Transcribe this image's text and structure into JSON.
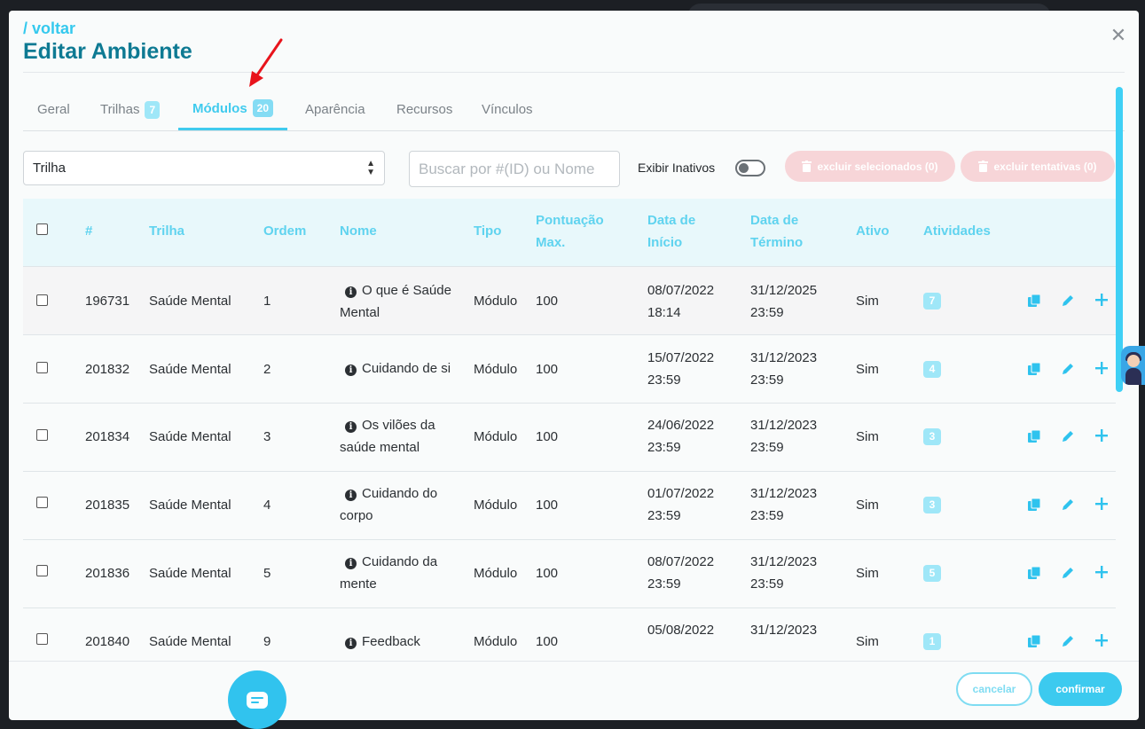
{
  "header": {
    "back_link": "/ voltar",
    "title": "Editar Ambiente",
    "close_symbol": "✕"
  },
  "tabs": [
    {
      "label": "Geral",
      "badge": null
    },
    {
      "label": "Trilhas",
      "badge": "7"
    },
    {
      "label": "Módulos",
      "badge": "20",
      "active": true
    },
    {
      "label": "Aparência",
      "badge": null
    },
    {
      "label": "Recursos",
      "badge": null
    },
    {
      "label": "Vínculos",
      "badge": null
    }
  ],
  "filters": {
    "trail_select_value": "Trilha",
    "search_placeholder": "Buscar por #(ID) ou Nome",
    "show_inactive_label": "Exibir Inativos",
    "show_inactive_on": false,
    "delete_selected_label": "excluir selecionados (0)",
    "delete_attempts_label": "excluir tentativas (0)"
  },
  "table": {
    "headers": {
      "id": "#",
      "trail": "Trilha",
      "order": "Ordem",
      "name": "Nome",
      "type": "Tipo",
      "max_score_l1": "Pontuação",
      "max_score_l2": "Max.",
      "start_l1": "Data de",
      "start_l2": "Início",
      "end_l1": "Data de",
      "end_l2": "Término",
      "active": "Ativo",
      "activities": "Atividades"
    },
    "rows": [
      {
        "id": "196731",
        "trail": "Saúde Mental",
        "order": "1",
        "name_l1": "O que é Saúde",
        "name_l2": "Mental",
        "type": "Módulo",
        "score": "100",
        "start_date": "08/07/2022",
        "start_time": "18:14",
        "end_date": "31/12/2025",
        "end_time": "23:59",
        "active": "Sim",
        "activities": "7"
      },
      {
        "id": "201832",
        "trail": "Saúde Mental",
        "order": "2",
        "name_l1": "Cuidando de si",
        "name_l2": "",
        "type": "Módulo",
        "score": "100",
        "start_date": "15/07/2022",
        "start_time": "23:59",
        "end_date": "31/12/2023",
        "end_time": "23:59",
        "active": "Sim",
        "activities": "4"
      },
      {
        "id": "201834",
        "trail": "Saúde Mental",
        "order": "3",
        "name_l1": "Os vilões da",
        "name_l2": "saúde mental",
        "type": "Módulo",
        "score": "100",
        "start_date": "24/06/2022",
        "start_time": "23:59",
        "end_date": "31/12/2023",
        "end_time": "23:59",
        "active": "Sim",
        "activities": "3"
      },
      {
        "id": "201835",
        "trail": "Saúde Mental",
        "order": "4",
        "name_l1": "Cuidando do",
        "name_l2": "corpo",
        "type": "Módulo",
        "score": "100",
        "start_date": "01/07/2022",
        "start_time": "23:59",
        "end_date": "31/12/2023",
        "end_time": "23:59",
        "active": "Sim",
        "activities": "3"
      },
      {
        "id": "201836",
        "trail": "Saúde Mental",
        "order": "5",
        "name_l1": "Cuidando da",
        "name_l2": "mente",
        "type": "Módulo",
        "score": "100",
        "start_date": "08/07/2022",
        "start_time": "23:59",
        "end_date": "31/12/2023",
        "end_time": "23:59",
        "active": "Sim",
        "activities": "5"
      },
      {
        "id": "201840",
        "trail": "Saúde Mental",
        "order": "9",
        "name_l1": "Feedback",
        "name_l2": "",
        "type": "Módulo",
        "score": "100",
        "start_date": "05/08/2022",
        "start_time": "",
        "end_date": "31/12/2023",
        "end_time": "",
        "active": "Sim",
        "activities": "1"
      }
    ],
    "row_action_icons": [
      "copy-icon",
      "edit-pencil-icon",
      "plus-icon"
    ]
  },
  "footer": {
    "cancel_label": "cancelar",
    "confirm_label": "confirmar"
  },
  "colors": {
    "accent": "#3ccaef",
    "title": "#0e7a93",
    "danger_pill": "#f7d5d8",
    "annotation_arrow": "#e8141c"
  }
}
